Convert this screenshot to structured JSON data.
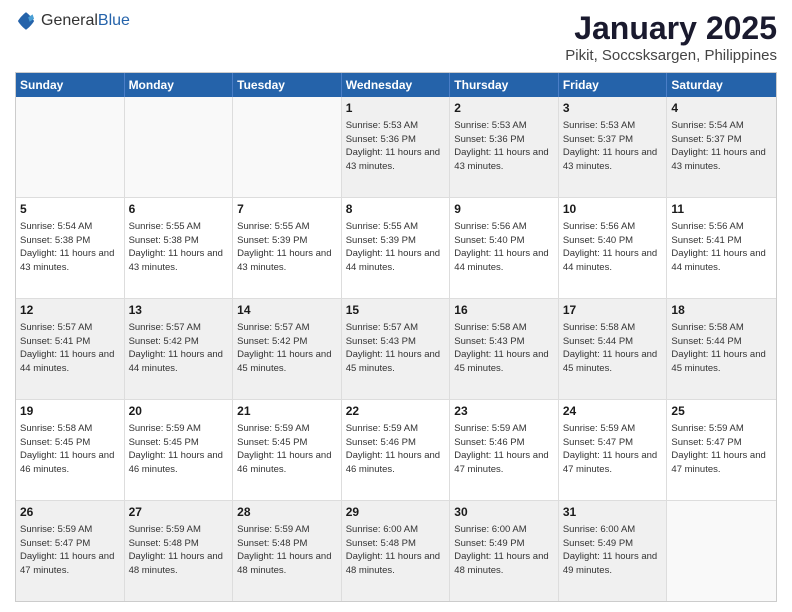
{
  "header": {
    "logo_general": "General",
    "logo_blue": "Blue",
    "title": "January 2025",
    "subtitle": "Pikit, Soccsksargen, Philippines"
  },
  "calendar": {
    "days_of_week": [
      "Sunday",
      "Monday",
      "Tuesday",
      "Wednesday",
      "Thursday",
      "Friday",
      "Saturday"
    ],
    "rows": [
      [
        {
          "day": "",
          "empty": true
        },
        {
          "day": "",
          "empty": true
        },
        {
          "day": "",
          "empty": true
        },
        {
          "day": "1",
          "sunrise": "5:53 AM",
          "sunset": "5:36 PM",
          "daylight": "11 hours and 43 minutes."
        },
        {
          "day": "2",
          "sunrise": "5:53 AM",
          "sunset": "5:36 PM",
          "daylight": "11 hours and 43 minutes."
        },
        {
          "day": "3",
          "sunrise": "5:53 AM",
          "sunset": "5:37 PM",
          "daylight": "11 hours and 43 minutes."
        },
        {
          "day": "4",
          "sunrise": "5:54 AM",
          "sunset": "5:37 PM",
          "daylight": "11 hours and 43 minutes."
        }
      ],
      [
        {
          "day": "5",
          "sunrise": "5:54 AM",
          "sunset": "5:38 PM",
          "daylight": "11 hours and 43 minutes."
        },
        {
          "day": "6",
          "sunrise": "5:55 AM",
          "sunset": "5:38 PM",
          "daylight": "11 hours and 43 minutes."
        },
        {
          "day": "7",
          "sunrise": "5:55 AM",
          "sunset": "5:39 PM",
          "daylight": "11 hours and 43 minutes."
        },
        {
          "day": "8",
          "sunrise": "5:55 AM",
          "sunset": "5:39 PM",
          "daylight": "11 hours and 44 minutes."
        },
        {
          "day": "9",
          "sunrise": "5:56 AM",
          "sunset": "5:40 PM",
          "daylight": "11 hours and 44 minutes."
        },
        {
          "day": "10",
          "sunrise": "5:56 AM",
          "sunset": "5:40 PM",
          "daylight": "11 hours and 44 minutes."
        },
        {
          "day": "11",
          "sunrise": "5:56 AM",
          "sunset": "5:41 PM",
          "daylight": "11 hours and 44 minutes."
        }
      ],
      [
        {
          "day": "12",
          "sunrise": "5:57 AM",
          "sunset": "5:41 PM",
          "daylight": "11 hours and 44 minutes."
        },
        {
          "day": "13",
          "sunrise": "5:57 AM",
          "sunset": "5:42 PM",
          "daylight": "11 hours and 44 minutes."
        },
        {
          "day": "14",
          "sunrise": "5:57 AM",
          "sunset": "5:42 PM",
          "daylight": "11 hours and 45 minutes."
        },
        {
          "day": "15",
          "sunrise": "5:57 AM",
          "sunset": "5:43 PM",
          "daylight": "11 hours and 45 minutes."
        },
        {
          "day": "16",
          "sunrise": "5:58 AM",
          "sunset": "5:43 PM",
          "daylight": "11 hours and 45 minutes."
        },
        {
          "day": "17",
          "sunrise": "5:58 AM",
          "sunset": "5:44 PM",
          "daylight": "11 hours and 45 minutes."
        },
        {
          "day": "18",
          "sunrise": "5:58 AM",
          "sunset": "5:44 PM",
          "daylight": "11 hours and 45 minutes."
        }
      ],
      [
        {
          "day": "19",
          "sunrise": "5:58 AM",
          "sunset": "5:45 PM",
          "daylight": "11 hours and 46 minutes."
        },
        {
          "day": "20",
          "sunrise": "5:59 AM",
          "sunset": "5:45 PM",
          "daylight": "11 hours and 46 minutes."
        },
        {
          "day": "21",
          "sunrise": "5:59 AM",
          "sunset": "5:45 PM",
          "daylight": "11 hours and 46 minutes."
        },
        {
          "day": "22",
          "sunrise": "5:59 AM",
          "sunset": "5:46 PM",
          "daylight": "11 hours and 46 minutes."
        },
        {
          "day": "23",
          "sunrise": "5:59 AM",
          "sunset": "5:46 PM",
          "daylight": "11 hours and 47 minutes."
        },
        {
          "day": "24",
          "sunrise": "5:59 AM",
          "sunset": "5:47 PM",
          "daylight": "11 hours and 47 minutes."
        },
        {
          "day": "25",
          "sunrise": "5:59 AM",
          "sunset": "5:47 PM",
          "daylight": "11 hours and 47 minutes."
        }
      ],
      [
        {
          "day": "26",
          "sunrise": "5:59 AM",
          "sunset": "5:47 PM",
          "daylight": "11 hours and 47 minutes."
        },
        {
          "day": "27",
          "sunrise": "5:59 AM",
          "sunset": "5:48 PM",
          "daylight": "11 hours and 48 minutes."
        },
        {
          "day": "28",
          "sunrise": "5:59 AM",
          "sunset": "5:48 PM",
          "daylight": "11 hours and 48 minutes."
        },
        {
          "day": "29",
          "sunrise": "6:00 AM",
          "sunset": "5:48 PM",
          "daylight": "11 hours and 48 minutes."
        },
        {
          "day": "30",
          "sunrise": "6:00 AM",
          "sunset": "5:49 PM",
          "daylight": "11 hours and 48 minutes."
        },
        {
          "day": "31",
          "sunrise": "6:00 AM",
          "sunset": "5:49 PM",
          "daylight": "11 hours and 49 minutes."
        },
        {
          "day": "",
          "empty": true
        }
      ]
    ]
  }
}
